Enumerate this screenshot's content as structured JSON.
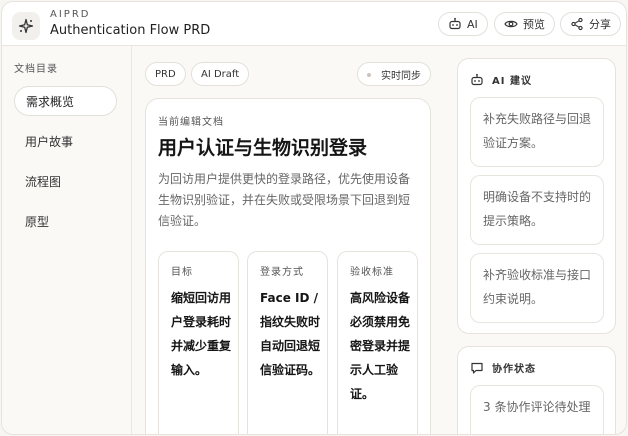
{
  "header": {
    "brand": "AIPRD",
    "title": "Authentication Flow PRD",
    "buttons": [
      {
        "label": "AI",
        "icon": "robot-icon"
      },
      {
        "label": "预览",
        "icon": "eye-icon"
      },
      {
        "label": "分享",
        "icon": "share-icon"
      }
    ]
  },
  "sidebar": {
    "title": "文档目录",
    "items": [
      {
        "label": "需求概览",
        "active": true
      },
      {
        "label": "用户故事",
        "active": false
      },
      {
        "label": "流程图",
        "active": false
      },
      {
        "label": "原型",
        "active": false
      }
    ]
  },
  "main": {
    "chips": [
      "PRD",
      "AI Draft"
    ],
    "sync_label": "实时同步",
    "card": {
      "label": "当前编辑文档",
      "heading": "用户认证与生物识别登录",
      "description": "为回访用户提供更快的登录路径，优先使用设备生物识别验证，并在失败或受限场景下回退到短信验证。",
      "columns": [
        {
          "title": "目标",
          "body": "缩短回访用户登录耗时并减少重复输入。"
        },
        {
          "title": "登录方式",
          "body": "Face ID / 指纹失败时自动回退短信验证码。"
        },
        {
          "title": "验收标准",
          "body": "高风险设备必须禁用免密登录并提示人工验证。"
        }
      ]
    }
  },
  "right": {
    "ai_panel": {
      "title": "AI 建议",
      "suggestions": [
        "补充失败路径与回退验证方案。",
        "明确设备不支持时的提示策略。",
        "补齐验收标准与接口约束说明。"
      ]
    },
    "collab_panel": {
      "title": "协作状态",
      "status": "3 条协作评论待处理"
    }
  },
  "colors": {
    "background": "#faf9f6",
    "card": "#ffffff",
    "border": "#e6e3dd",
    "text_primary": "#1f1f1f",
    "text_muted": "#666666"
  }
}
